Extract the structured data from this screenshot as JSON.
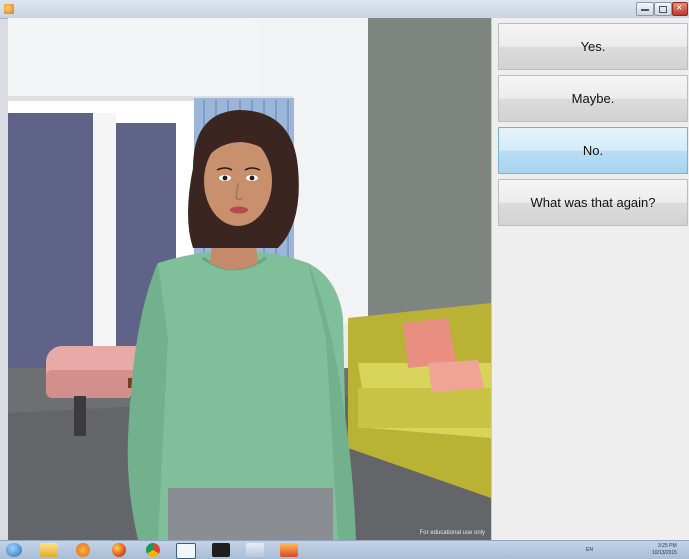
{
  "window": {
    "title_icon": "app-icon"
  },
  "responses": [
    {
      "label": "Yes.",
      "state": "normal"
    },
    {
      "label": "Maybe.",
      "state": "normal"
    },
    {
      "label": "No.",
      "state": "hover"
    },
    {
      "label": "What was that again?",
      "state": "normal"
    }
  ],
  "scene": {
    "footer_note": "For educational use only"
  },
  "taskbar": {
    "items": [
      "start-orb-icon",
      "folder-icon",
      "media-player-icon",
      "firefox-icon",
      "chrome-icon",
      "app-icon",
      "terminal-icon",
      "app-icon",
      "app-icon"
    ],
    "tray_language": "EN",
    "time": "3:25 PM",
    "date": "10/13/2015"
  }
}
